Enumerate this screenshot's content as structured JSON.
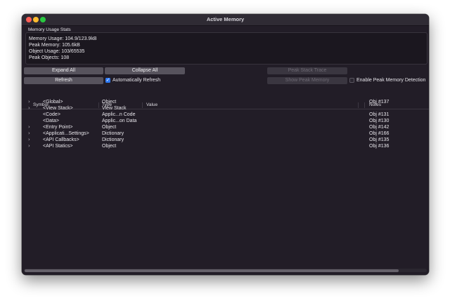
{
  "window": {
    "title": "Active Memory"
  },
  "stats": {
    "title": "Memory Usage Stats",
    "lines": [
      "Memory Usage: 104.9/123.9kB",
      "Peak Memory: 105.6kB",
      "Object Usage: 103/65535",
      "Peak Objects: 108"
    ]
  },
  "controls": {
    "expand_all": "Expand All",
    "collapse_all": "Collapse All",
    "refresh": "Refresh",
    "auto_refresh_label": "Automatically Refresh",
    "auto_refresh_checked": true,
    "peak_stack_trace": "Peak Stack Trace",
    "show_peak_memory": "Show Peak Memory",
    "enable_peak_label": "Enable Peak Memory Detection",
    "enable_peak_checked": false
  },
  "table": {
    "headers": {
      "symbol": "Symbol",
      "type": "Type",
      "value": "Value",
      "notes": "Notes"
    },
    "rows": [
      {
        "expandable": true,
        "symbol": "<Global>",
        "type": "Object",
        "value": "",
        "notes": "Obj #137"
      },
      {
        "expandable": true,
        "symbol": "<View Stack>",
        "type": "View Stack",
        "value": "",
        "notes": ""
      },
      {
        "expandable": false,
        "symbol": "<Code>",
        "type": "Applic...n Code",
        "value": "",
        "notes": "Obj #131"
      },
      {
        "expandable": false,
        "symbol": "<Data>",
        "type": "Applic...on Data",
        "value": "",
        "notes": "Obj #130"
      },
      {
        "expandable": true,
        "symbol": "<Entry Point>",
        "type": "Object",
        "value": "",
        "notes": "Obj #142"
      },
      {
        "expandable": true,
        "symbol": "<Applicati...Settings>",
        "type": "Dictionary",
        "value": "",
        "notes": "Obj #166"
      },
      {
        "expandable": true,
        "symbol": "<API Callbacks>",
        "type": "Dictionary",
        "value": "",
        "notes": "Obj #135"
      },
      {
        "expandable": true,
        "symbol": "<API Statics>",
        "type": "Object",
        "value": "",
        "notes": "Obj #136"
      }
    ]
  },
  "icons": {
    "close": "close-icon",
    "minimize": "minimize-icon",
    "zoom": "zoom-icon",
    "disclosure": "chevron-right-icon",
    "check": "checkmark-icon"
  },
  "colors": {
    "background": "#221d27",
    "button": "#57535d",
    "accent": "#2f7bf6"
  }
}
